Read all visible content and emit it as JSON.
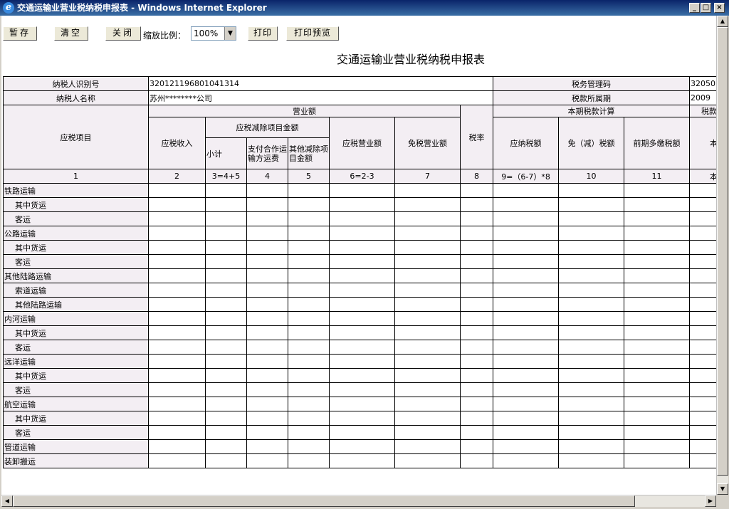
{
  "window": {
    "title": "交通运输业营业税纳税申报表 - Windows Internet Explorer"
  },
  "toolbar": {
    "save_label": "暂存",
    "clear_label": "清空",
    "close_label": "关闭",
    "zoom_label": "缩放比例：",
    "zoom_value": "100%",
    "print_label": "打印",
    "preview_label": "打印预览"
  },
  "report": {
    "title": "交通运输业营业税纳税申报表",
    "taxpayer_id_label": "纳税人识别号",
    "taxpayer_id": "320121196801041314",
    "tax_code_label": "税务管理码",
    "tax_code": "32050",
    "taxpayer_name_label": "纳税人名称",
    "taxpayer_name": "苏州********公司",
    "period_label": "税款所属期",
    "period": "2009",
    "headers": {
      "item": "应税项目",
      "business_amount": "营业额",
      "current_tax_calc": "本期税款计算",
      "tax_partial": "税款",
      "taxable_income": "应税收入",
      "deduction": "应税减除项目金额",
      "subtotal": "小计",
      "coop_freight": "支付合作运输方运费",
      "other_deduction": "其他减除项目金额",
      "taxable_turnover": "应税营业额",
      "exempt_turnover": "免税营业额",
      "tax_rate": "税率",
      "payable_tax": "应纳税额",
      "exempt_tax": "免（减）税额",
      "prior_overpaid": "前期多缴税额",
      "current_paid": "本期缴"
    },
    "numbers": [
      "1",
      "2",
      "3=4+5",
      "4",
      "5",
      "6=2-3",
      "7",
      "8",
      "9=（6-7）*8",
      "10",
      "11",
      "本"
    ],
    "rows": [
      {
        "label": "铁路运输"
      },
      {
        "label": "其中货运"
      },
      {
        "label": "客运"
      },
      {
        "label": "公路运输"
      },
      {
        "label": "其中货运"
      },
      {
        "label": "客运"
      },
      {
        "label": "其他陆路运输"
      },
      {
        "label": "索道运输"
      },
      {
        "label": "其他陆路运输"
      },
      {
        "label": "内河运输"
      },
      {
        "label": "其中货运"
      },
      {
        "label": "客运"
      },
      {
        "label": "远洋运输"
      },
      {
        "label": "其中货运"
      },
      {
        "label": "客运"
      },
      {
        "label": "航空运输"
      },
      {
        "label": "其中货运"
      },
      {
        "label": "客运"
      },
      {
        "label": "管道运输"
      },
      {
        "label": "装卸搬运"
      }
    ]
  }
}
